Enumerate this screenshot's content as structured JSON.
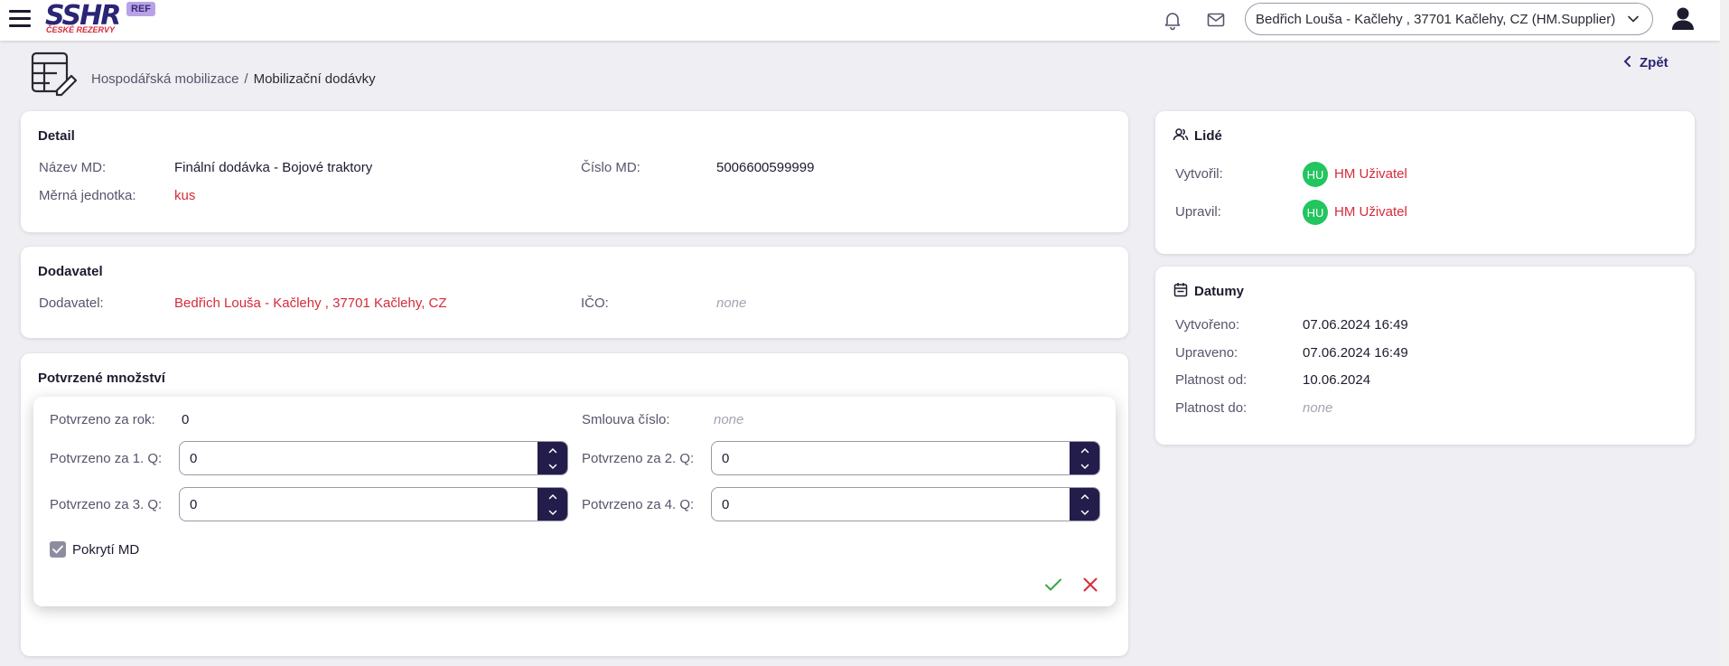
{
  "app": {
    "logo_text": "SSHR",
    "logo_subtitle": "ČESKÉ REZERVY",
    "env_badge": "REF",
    "supplier_selector": "Bedřich Louša - Kačlehy , 37701 Kačlehy, CZ (HM.Supplier)"
  },
  "breadcrumb": {
    "parent": "Hospodářská mobilizace",
    "separator": "/",
    "current": "Mobilizační dodávky"
  },
  "back_label": "Zpět",
  "detail": {
    "title": "Detail",
    "name_label": "Název MD:",
    "name_value": "Finální dodávka - Bojové traktory",
    "number_label": "Číslo MD:",
    "number_value": "5006600599999",
    "unit_label": "Měrná jednotka:",
    "unit_value": "kus"
  },
  "supplier": {
    "title": "Dodavatel",
    "supplier_label": "Dodavatel:",
    "supplier_value": "Bedřich Louša - Kačlehy , 37701 Kačlehy, CZ",
    "ico_label": "IČO:",
    "ico_value": "none"
  },
  "quantities": {
    "title": "Potvrzené množství",
    "year_label": "Potvrzeno za rok:",
    "year_value": "0",
    "contract_label": "Smlouva číslo:",
    "contract_value": "none",
    "q1_label": "Potvrzeno za 1. Q:",
    "q1_value": "0",
    "q2_label": "Potvrzeno za 2. Q:",
    "q2_value": "0",
    "q3_label": "Potvrzeno za 3. Q:",
    "q3_value": "0",
    "q4_label": "Potvrzeno za 4. Q:",
    "q4_value": "0",
    "coverage_label": "Pokrytí MD",
    "coverage_checked": true
  },
  "people": {
    "title": "Lidé",
    "created_by_label": "Vytvořil:",
    "created_by_initials": "HU",
    "created_by_name": "HM Uživatel",
    "modified_by_label": "Upravil:",
    "modified_by_initials": "HU",
    "modified_by_name": "HM Uživatel"
  },
  "dates": {
    "title": "Datumy",
    "created_label": "Vytvořeno:",
    "created_value": "07.06.2024 16:49",
    "modified_label": "Upraveno:",
    "modified_value": "07.06.2024 16:49",
    "valid_from_label": "Platnost od:",
    "valid_from_value": "10.06.2024",
    "valid_to_label": "Platnost do:",
    "valid_to_value": "none"
  },
  "colors": {
    "brand": "#2b2576",
    "accent_red": "#d62b3a",
    "stepper": "#221d4a",
    "avatar": "#22c55e",
    "confirm": "#3aa544"
  },
  "icons": [
    "menu-icon",
    "bell-icon",
    "mail-icon",
    "chevron-down-icon",
    "user-icon",
    "table-edit-icon",
    "chevron-left-icon",
    "people-icon",
    "calendar-icon",
    "check-icon",
    "close-icon"
  ]
}
